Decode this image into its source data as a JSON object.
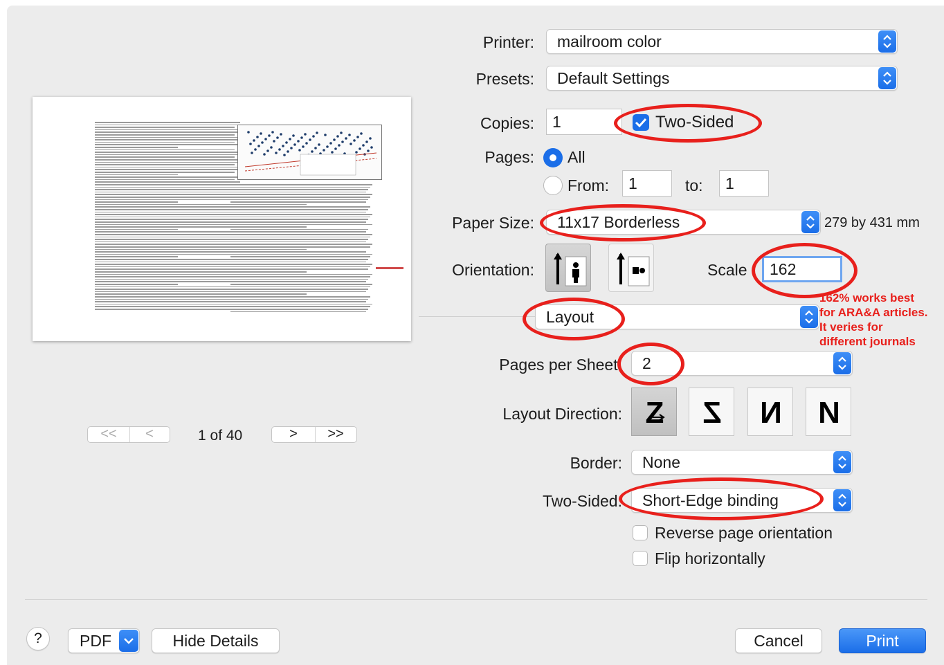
{
  "printer": {
    "label": "Printer:",
    "value": "mailroom color"
  },
  "presets": {
    "label": "Presets:",
    "value": "Default Settings"
  },
  "copies": {
    "label": "Copies:",
    "value": "1",
    "two_sided_label": "Two-Sided",
    "two_sided_checked": true
  },
  "pages": {
    "label": "Pages:",
    "all_label": "All",
    "from_label": "From:",
    "from_value": "1",
    "to_label": "to:",
    "to_value": "1"
  },
  "paper_size": {
    "label": "Paper Size:",
    "value": "11x17 Borderless",
    "dimensions": "279 by 431 mm"
  },
  "orientation": {
    "label": "Orientation:",
    "portrait_icon": "portrait-orientation-icon",
    "landscape_icon": "landscape-orientation-icon"
  },
  "scale": {
    "label": "Scale",
    "value": "162"
  },
  "annotation": {
    "line1": "162% works best",
    "line2": "for ARA&A articles.",
    "line3": "It veries for",
    "line4": "different journals",
    "color": "#e8201c"
  },
  "section_popup": {
    "value": "Layout"
  },
  "layout": {
    "pages_per_sheet_label": "Pages per Sheet:",
    "pages_per_sheet_value": "2",
    "layout_direction_label": "Layout Direction:",
    "border_label": "Border:",
    "border_value": "None",
    "two_sided_label": "Two-Sided:",
    "two_sided_value": "Short-Edge binding",
    "reverse_label": "Reverse page orientation",
    "flip_label": "Flip horizontally"
  },
  "preview": {
    "page_indicator": "1 of 40",
    "first": "<<",
    "prev": "<",
    "next": ">",
    "last": ">>"
  },
  "footer": {
    "help": "?",
    "pdf": "PDF",
    "hide_details": "Hide Details",
    "cancel": "Cancel",
    "print": "Print"
  },
  "colors": {
    "accent": "#1b6ee8",
    "highlight": "#e8201c"
  }
}
